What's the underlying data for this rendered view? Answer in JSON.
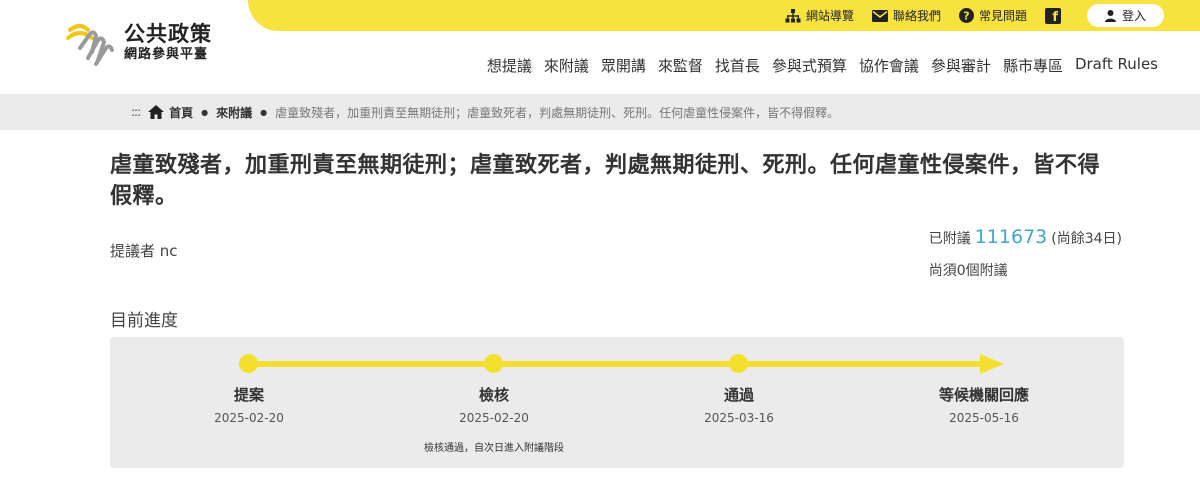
{
  "header": {
    "logo_title": "公共政策",
    "logo_subtitle": "網路參與平臺",
    "utility": {
      "sitemap": "網站導覽",
      "contact": "聯絡我們",
      "faq": "常見問題",
      "facebook": "f",
      "login": "登入"
    },
    "nav": [
      "想提議",
      "來附議",
      "眾開講",
      "來監督",
      "找首長",
      "參與式預算",
      "協作會議",
      "參與審計",
      "縣市專區",
      "Draft Rules"
    ]
  },
  "breadcrumb": {
    "dots": ":::",
    "home": "首頁",
    "section": "來附議",
    "current": "虐童致殘者，加重刑責至無期徒刑；虐童致死者，判處無期徒刑、死刑。任何虐童性侵案件，皆不得假釋。"
  },
  "proposal": {
    "title": "虐童致殘者，加重刑責至無期徒刑；虐童致死者，判處無期徒刑、死刑。任何虐童性侵案件，皆不得假釋。",
    "proposer": "提議者 nc",
    "signed_label": "已附議",
    "signed_count": "111673",
    "remaining_days": "(尚餘34日)",
    "needed": "尚須0個附議"
  },
  "progress": {
    "label": "目前進度",
    "steps": [
      {
        "name": "提案",
        "date": "2025-02-20",
        "note": ""
      },
      {
        "name": "檢核",
        "date": "2025-02-20",
        "note": "檢核通過，自次日進入附議階段"
      },
      {
        "name": "通過",
        "date": "2025-03-16",
        "note": ""
      },
      {
        "name": "等候機關回應",
        "date": "2025-05-16",
        "note": ""
      }
    ]
  },
  "colors": {
    "accent_yellow": "#f6e33f",
    "count_blue": "#3da6d1",
    "breadcrumb_bg": "#ebebeb"
  }
}
